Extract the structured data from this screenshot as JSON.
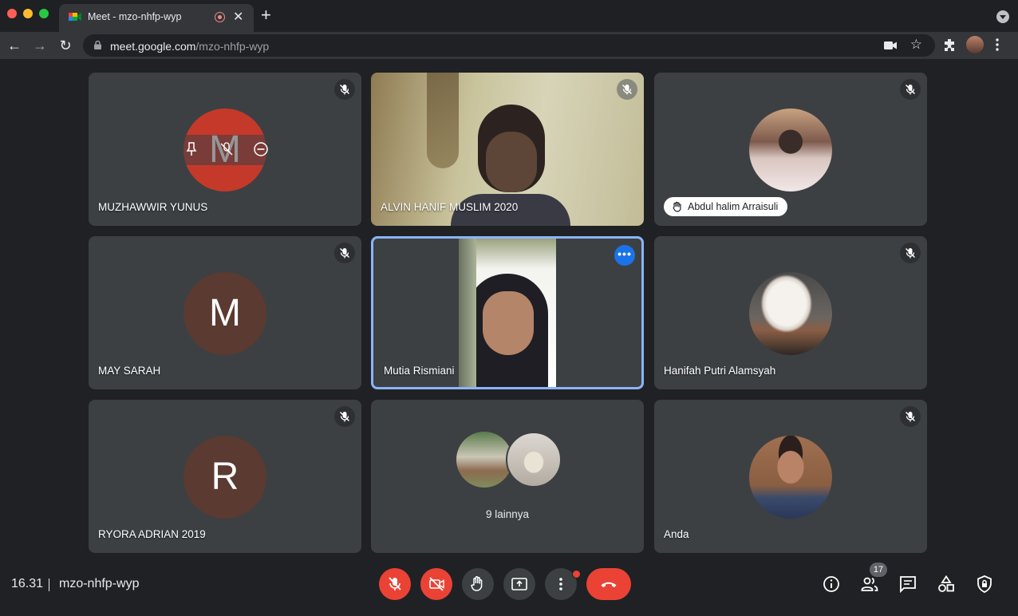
{
  "browser": {
    "tab_title": "Meet - mzo-nhfp-wyp",
    "url_host": "meet.google.com",
    "url_path": "/mzo-nhfp-wyp",
    "traffic_colors": [
      "#ff5f57",
      "#febc2e",
      "#28c840"
    ]
  },
  "tiles": [
    {
      "name": "MUZHAWWIR YUNUS",
      "avatar_letter": "M",
      "avatar_color": "#c5392a",
      "muted": true,
      "video": false
    },
    {
      "name": "ALVIN HANIF MUSLIM 2020",
      "muted": true,
      "video": true
    },
    {
      "name": "Abdul halim Arraisuli",
      "muted": true,
      "hand_raised": true,
      "photo": true
    },
    {
      "name": "MAY SARAH",
      "avatar_letter": "M",
      "avatar_color": "#5b3a31",
      "muted": true
    },
    {
      "name": "Mutia Rismiani",
      "video": true,
      "active_speaker": true
    },
    {
      "name": "Hanifah Putri Alamsyah",
      "muted": true,
      "photo": true
    },
    {
      "name": "RYORA ADRIAN 2019",
      "avatar_letter": "R",
      "avatar_color": "#5b3a31",
      "muted": true
    },
    {
      "label": "9 lainnya"
    },
    {
      "name": "Anda",
      "muted": true,
      "photo": true
    }
  ],
  "bottom": {
    "time": "16.31",
    "meeting_code": "mzo-nhfp-wyp",
    "participant_count": "17"
  },
  "colors": {
    "background": "#202124",
    "tile": "#3c4043",
    "danger": "#ea4335",
    "accent": "#8ab4f8"
  }
}
